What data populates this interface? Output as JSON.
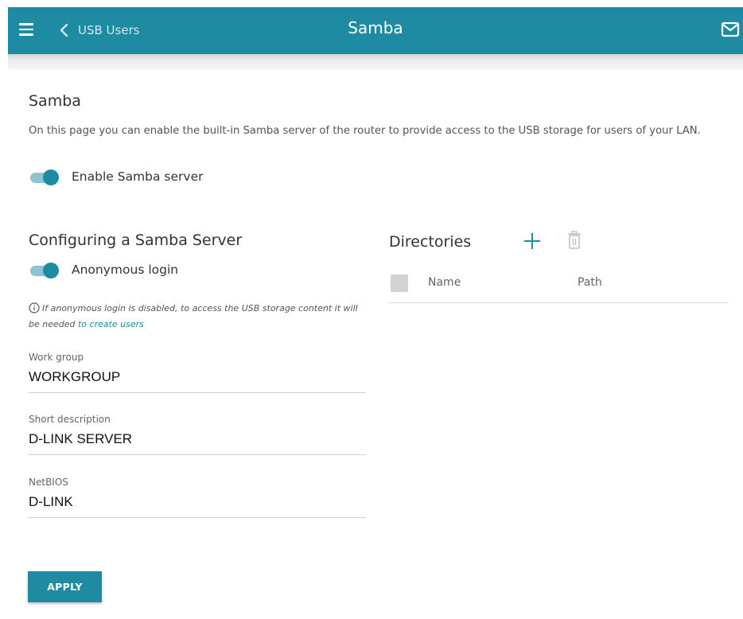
{
  "header": {
    "back_label": "USB Users",
    "title": "Samba",
    "accent_color": "#1f8ba3",
    "menu_icon": "hamburger-icon",
    "back_icon": "chevron-left-icon",
    "mail_icon": "mail-icon"
  },
  "page": {
    "title": "Samba",
    "description": "On this page you can enable the built-in Samba server of the router to provide access to the USB storage for users of your LAN.",
    "enable_label": "Enable Samba server",
    "enable_on": true
  },
  "config": {
    "title": "Configuring a Samba Server",
    "anonymous_label": "Anonymous login",
    "anonymous_on": true,
    "hint_text": "If anonymous login is disabled, to access the USB storage content it will be needed ",
    "hint_link": "to create users",
    "fields": [
      {
        "label": "Work group",
        "value": "WORKGROUP"
      },
      {
        "label": "Short description",
        "value": "D-LINK SERVER"
      },
      {
        "label": "NetBIOS",
        "value": "D-LINK"
      }
    ],
    "apply_label": "APPLY"
  },
  "directories": {
    "title": "Directories",
    "columns": [
      "Name",
      "Path"
    ],
    "rows": []
  }
}
